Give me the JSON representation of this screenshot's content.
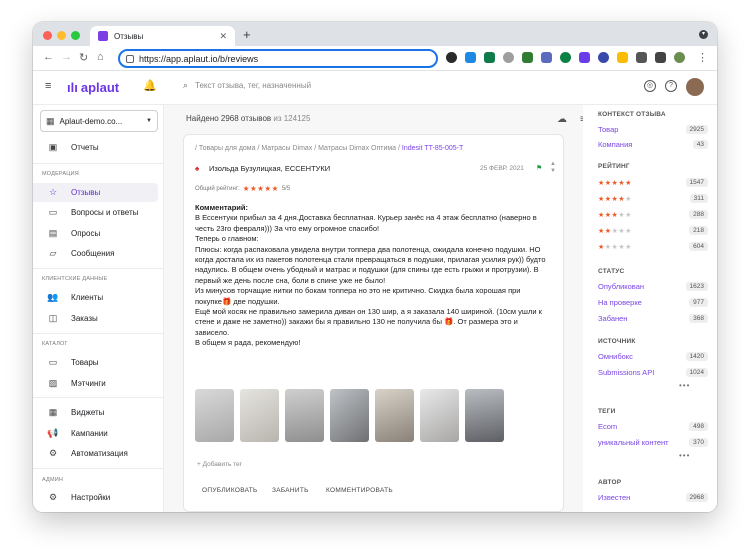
{
  "browser": {
    "tab_title": "Отзывы",
    "url": "https://app.aplaut.io/b/reviews"
  },
  "app": {
    "logo": "aplaut",
    "search_placeholder": "Текст отзыва, тег, назначенный"
  },
  "sidebar": {
    "store": "Aplaut-demo.co...",
    "reports": "Отчеты",
    "sections": {
      "moderation": "МОДЕРАЦИЯ",
      "clients": "КЛИЕНТСКИЕ ДАННЫЕ",
      "catalog": "КАТАЛОГ",
      "admin": "АДМИН"
    },
    "moderation_items": [
      "Отзывы",
      "Вопросы и ответы",
      "Опросы",
      "Сообщения"
    ],
    "client_items": [
      "Клиенты",
      "Заказы"
    ],
    "catalog_items": [
      "Товары",
      "Мэтчинги"
    ],
    "extra_items": [
      "Виджеты",
      "Кампании",
      "Автоматизация"
    ],
    "admin_items": [
      "Настройки"
    ]
  },
  "main": {
    "found_prefix": "Найдено 2968 отзывов",
    "found_suffix": "из 124125",
    "review": {
      "breadcrumb": "/ Товары для дома / Матрасы Dimax / Матрасы Dimax Оптима /",
      "breadcrumb_link": "Indesit TT-85-005-T",
      "author": "Изольда Бузулицкая, ЕССЕНТУКИ",
      "date": "25 ФЕВР. 2021",
      "rating_label": "Общий рейтинг:",
      "rating_stars": "★★★★★",
      "rating_value": "5/5",
      "comment_label": "Комментарий:",
      "lines": [
        "В Ессентуки прибыл за 4 дня.Доставка бесплатная. Курьер занёс на 4 этаж бесплатно (наверно в",
        "честь 23го февраля))) За что ему огромное спасибо!",
        "Теперь о главном:",
        "Плюсы: когда распаковала увидела внутри топпера два полотенца, ожидала конечно подушки. НО",
        "когда достала их из пакетов полотенца стали превращаться в подушки, прилагая усилия рук)) будто",
        "надулись. В общем очень убодный и матрас и подушки (для спины где есть грыжи и протрузии). В",
        "первый же день после сна, боли в спине уже не было!",
        "Из минусов торчащие нитки по бокам топпера но это не критично. Скидка была хорошая при",
        "покупке🎁 две подушки.",
        "Ещё мой косяк не правильно замерила диван он 130 шир, а я заказала 140 шириной. (10см ушли к",
        "стене и даже не заметно)) закажи бы я правильно 130 не получила бы 🎁. От размера это и",
        "зависело.",
        "В общем я рада, рекомендую!"
      ],
      "add_tag": "+ Добавить тег",
      "actions": [
        "ОПУБЛИКОВАТЬ",
        "ЗАБАНИТЬ",
        "КОММЕНТИРОВАТЬ"
      ]
    }
  },
  "right": {
    "context_title": "КОНТЕКСТ ОТЗЫВА",
    "context": [
      {
        "name": "Товар",
        "count": "2925"
      },
      {
        "name": "Компания",
        "count": "43"
      }
    ],
    "rating_title": "РЕЙТИНГ",
    "ratings": [
      {
        "on": "★★★★★",
        "off": "",
        "count": "1547"
      },
      {
        "on": "★★★★",
        "off": "★",
        "count": "311"
      },
      {
        "on": "★★★",
        "off": "★★",
        "count": "288"
      },
      {
        "on": "★★",
        "off": "★★★",
        "count": "218"
      },
      {
        "on": "★",
        "off": "★★★★",
        "count": "604"
      }
    ],
    "status_title": "СТАТУС",
    "status": [
      {
        "name": "Опубликован",
        "count": "1623"
      },
      {
        "name": "На проверке",
        "count": "977"
      },
      {
        "name": "Забанен",
        "count": "368"
      }
    ],
    "source_title": "ИСТОЧНИК",
    "source": [
      {
        "name": "Омнибокс",
        "count": "1420"
      },
      {
        "name": "Submissions API",
        "count": "1024"
      }
    ],
    "tags_title": "ТЕГИ",
    "tags": [
      {
        "name": "Ecom",
        "count": "498"
      },
      {
        "name": "уникальный контент",
        "count": "370"
      }
    ],
    "author_title": "АВТОР",
    "author": [
      {
        "name": "Известен",
        "count": "2968"
      }
    ],
    "more": "•••"
  }
}
